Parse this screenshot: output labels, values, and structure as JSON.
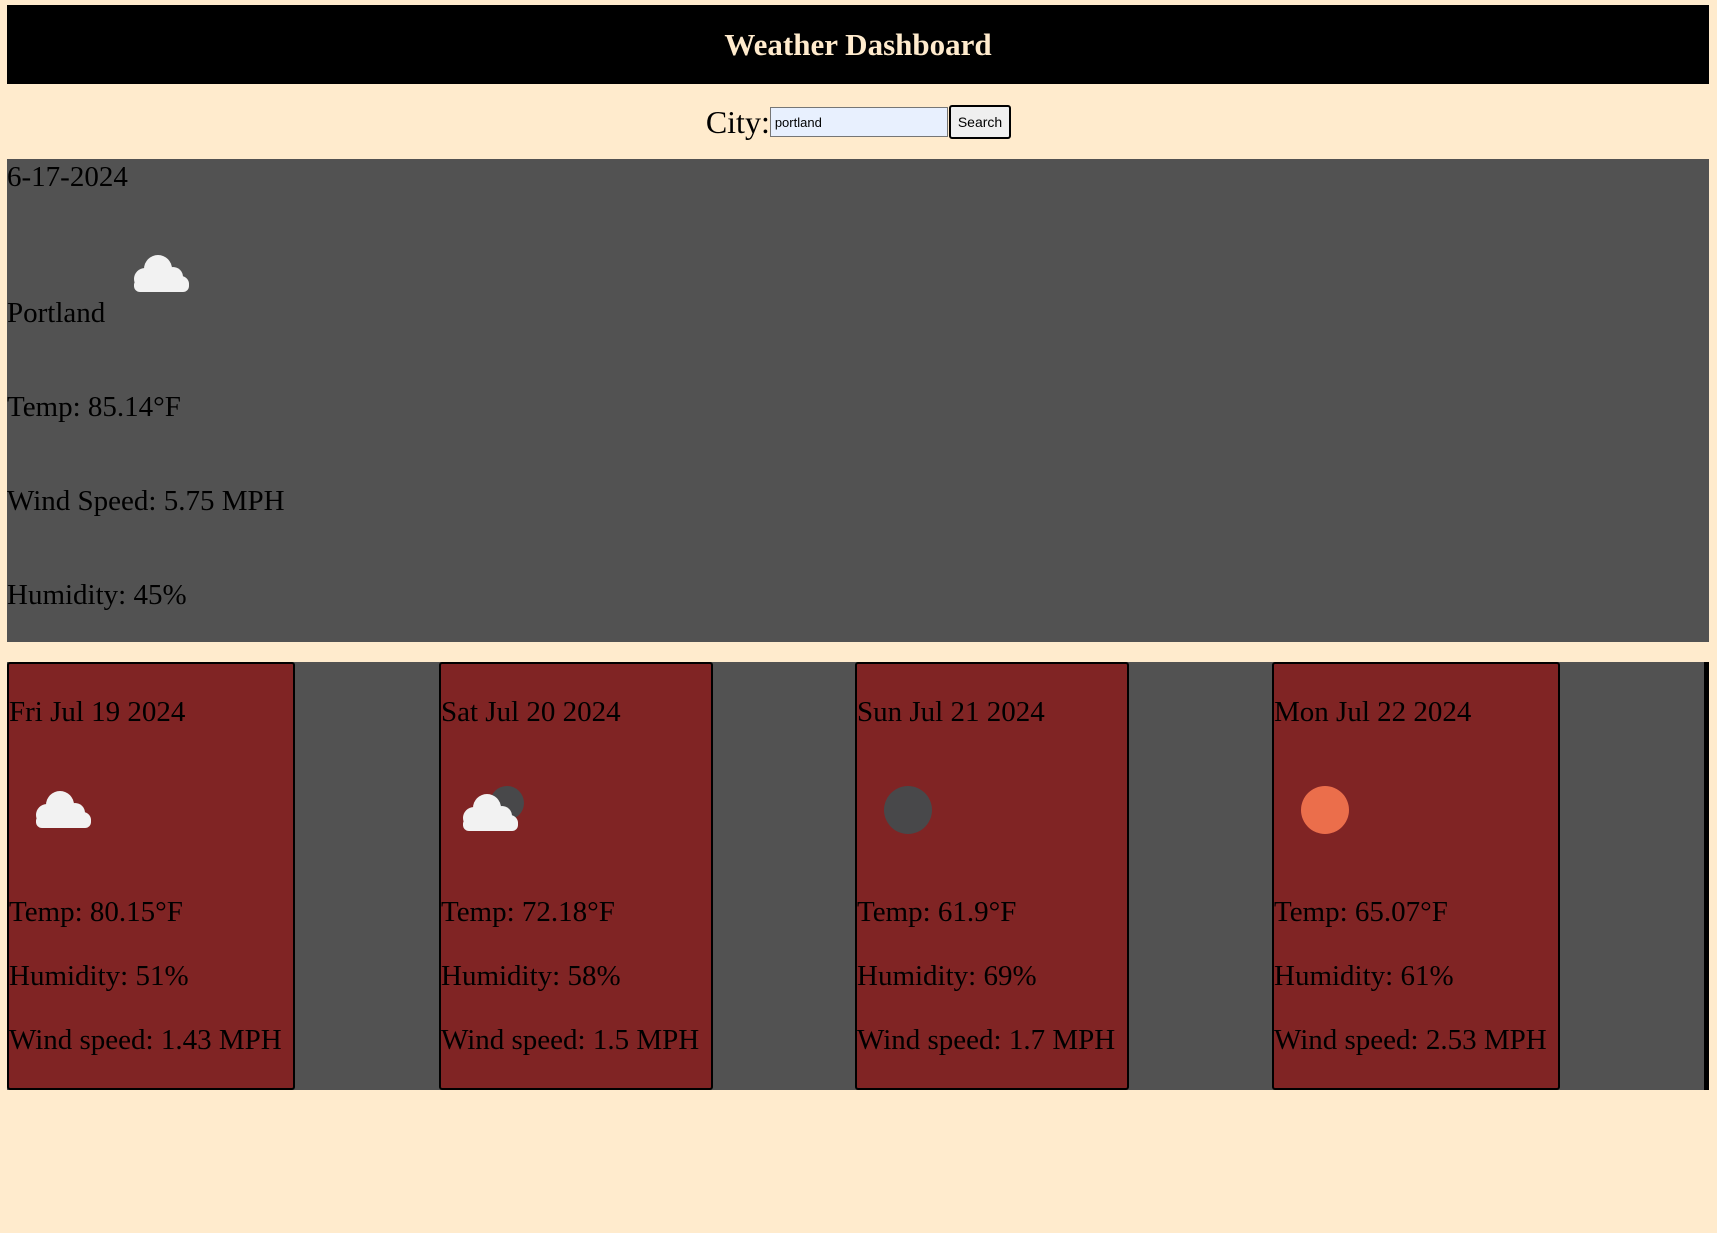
{
  "header": {
    "title": "Weather Dashboard"
  },
  "search": {
    "label": "City:",
    "value": "portland",
    "button_label": "Search"
  },
  "current": {
    "date": "6-17-2024",
    "city": "Portland",
    "icon": "cloud-icon",
    "temp": "Temp: 85.14°F",
    "wind": "Wind Speed: 5.75 MPH",
    "humidity": "Humidity: 45%"
  },
  "forecast": [
    {
      "date": "Fri Jul 19 2024",
      "icon": "cloud-icon",
      "temp": "Temp: 80.15°F",
      "humidity": "Humidity: 51%",
      "wind": "Wind speed: 1.43 MPH"
    },
    {
      "date": "Sat Jul 20 2024",
      "icon": "cloud-moon-icon",
      "temp": "Temp: 72.18°F",
      "humidity": "Humidity: 58%",
      "wind": "Wind speed: 1.5 MPH"
    },
    {
      "date": "Sun Jul 21 2024",
      "icon": "moon-icon",
      "temp": "Temp: 61.9°F",
      "humidity": "Humidity: 69%",
      "wind": "Wind speed: 1.7 MPH"
    },
    {
      "date": "Mon Jul 22 2024",
      "icon": "sun-icon",
      "temp": "Temp: 65.07°F",
      "humidity": "Humidity: 61%",
      "wind": "Wind speed: 2.53 MPH"
    }
  ],
  "colors": {
    "page_background": "#ffebcd",
    "header_background": "#000000",
    "panel_background": "#525252",
    "card_background": "#802424",
    "cloud": "#f2f2f2",
    "moon": "#48484a",
    "sun": "#eb6e4b"
  }
}
